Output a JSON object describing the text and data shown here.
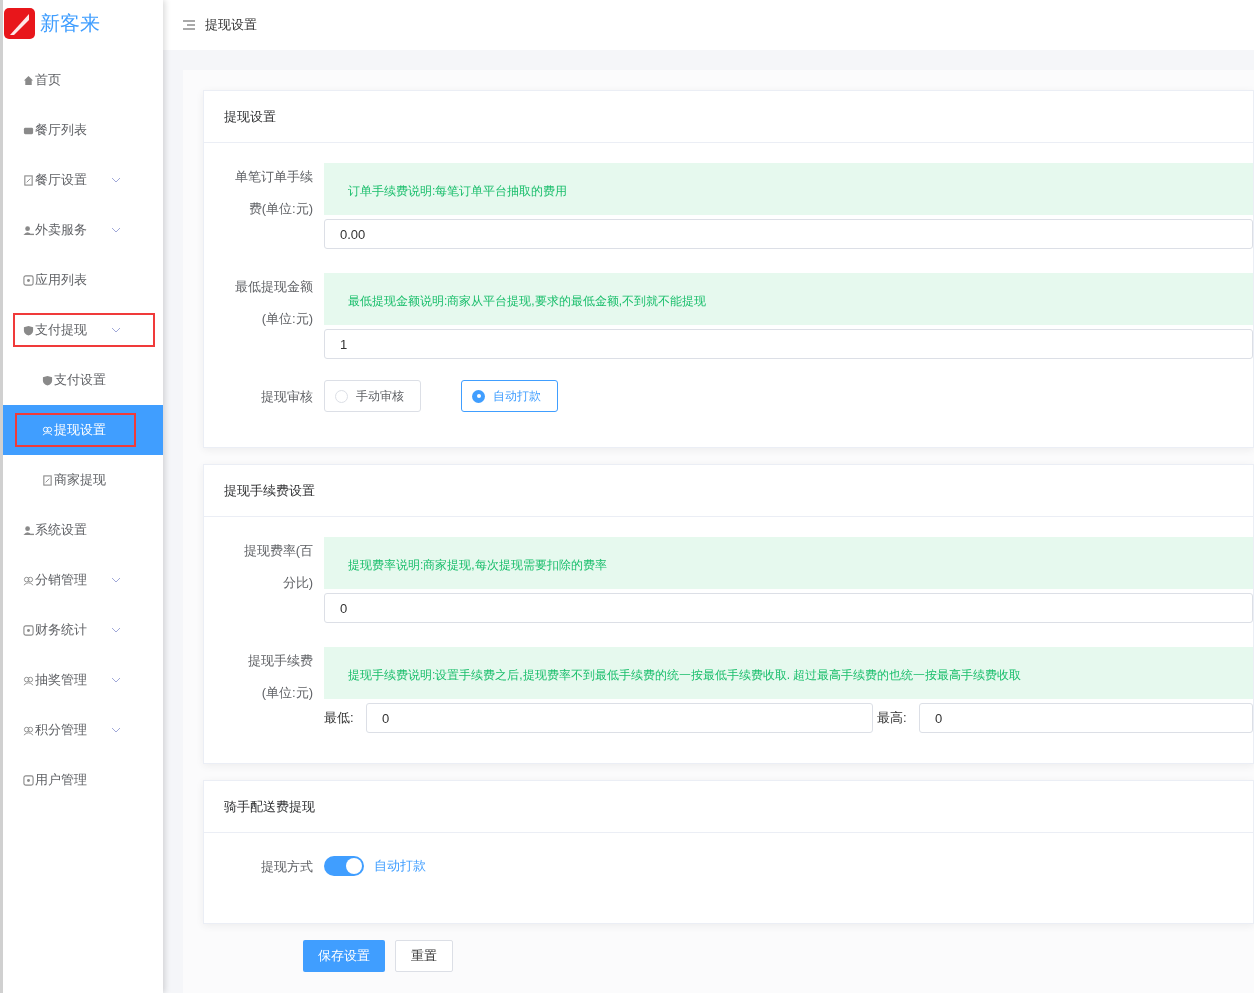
{
  "brand": {
    "name": "新客来"
  },
  "header": {
    "title": "提现设置"
  },
  "sidebar": {
    "items": [
      {
        "label": "首页",
        "expandable": false,
        "selected": false,
        "highlighted": false
      },
      {
        "label": "餐厅列表",
        "expandable": false,
        "selected": false,
        "highlighted": false
      },
      {
        "label": "餐厅设置",
        "expandable": true,
        "selected": false,
        "highlighted": false
      },
      {
        "label": "外卖服务",
        "expandable": true,
        "selected": false,
        "highlighted": false
      },
      {
        "label": "应用列表",
        "expandable": false,
        "selected": false,
        "highlighted": false
      },
      {
        "label": "支付提现",
        "expandable": true,
        "selected": false,
        "highlighted": true,
        "children": [
          {
            "label": "支付设置",
            "selected": false,
            "highlighted": false
          },
          {
            "label": "提现设置",
            "selected": true,
            "highlighted": true
          },
          {
            "label": "商家提现",
            "selected": false,
            "highlighted": false
          }
        ]
      },
      {
        "label": "系统设置",
        "expandable": false,
        "selected": false,
        "highlighted": false
      },
      {
        "label": "分销管理",
        "expandable": true,
        "selected": false,
        "highlighted": false
      },
      {
        "label": "财务统计",
        "expandable": true,
        "selected": false,
        "highlighted": false
      },
      {
        "label": "抽奖管理",
        "expandable": true,
        "selected": false,
        "highlighted": false
      },
      {
        "label": "积分管理",
        "expandable": true,
        "selected": false,
        "highlighted": false
      },
      {
        "label": "用户管理",
        "expandable": false,
        "selected": false,
        "highlighted": false
      }
    ]
  },
  "cards": [
    {
      "title": "提现设置",
      "fields": [
        {
          "kind": "input",
          "label": "单笔订单手续费(单位:元)",
          "notice": "订单手续费说明:每笔订单平台抽取的费用",
          "value": "0.00"
        },
        {
          "kind": "input",
          "label": "最低提现金额(单位:元)",
          "notice": "最低提现金额说明:商家从平台提现,要求的最低金额,不到就不能提现",
          "value": "1"
        },
        {
          "kind": "radio",
          "label": "提现审核",
          "options": [
            {
              "label": "手动审核",
              "selected": false
            },
            {
              "label": "自动打款",
              "selected": true
            }
          ]
        }
      ]
    },
    {
      "title": "提现手续费设置",
      "fields": [
        {
          "kind": "input",
          "label": "提现费率(百分比)",
          "notice": "提现费率说明:商家提现,每次提现需要扣除的费率",
          "value": "0"
        },
        {
          "kind": "range",
          "label": "提现手续费(单位:元)",
          "notice": "提现手续费说明:设置手续费之后,提现费率不到最低手续费的统一按最低手续费收取. 超过最高手续费的也统一按最高手续费收取",
          "min_label": "最低:",
          "min_value": "0",
          "max_label": "最高:",
          "max_value": "0"
        }
      ]
    },
    {
      "title": "骑手配送费提现",
      "fields": [
        {
          "kind": "switch",
          "label": "提现方式",
          "on": true,
          "text": "自动打款"
        }
      ]
    }
  ],
  "buttons": [
    {
      "label": "保存设置",
      "kind": "primary"
    },
    {
      "label": "重置",
      "kind": "default"
    }
  ]
}
